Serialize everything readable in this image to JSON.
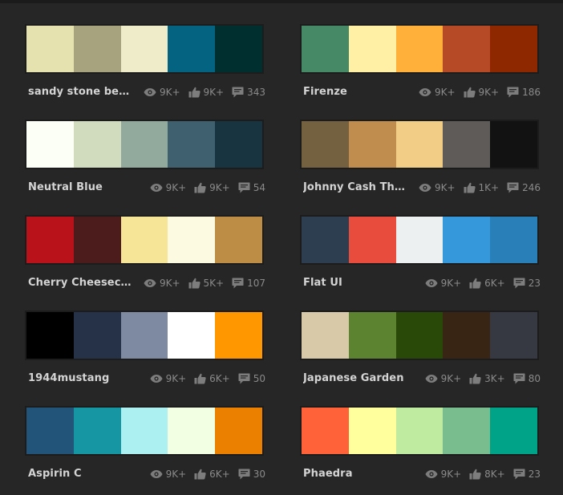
{
  "colors": {
    "background": "#262626",
    "text": "#d4d4d4",
    "muted": "#8a8a8a"
  },
  "icons": {
    "views": "eye-icon",
    "likes": "thumbs-up-icon",
    "comments": "comment-icon"
  },
  "themes": [
    {
      "name": "sandy stone beach ocean diver",
      "views": "9K+",
      "likes": "9K+",
      "comments": "343",
      "swatches": [
        "#E6E2AF",
        "#A7A37E",
        "#EFECCA",
        "#046380",
        "#002F2F"
      ]
    },
    {
      "name": "Firenze",
      "views": "9K+",
      "likes": "9K+",
      "comments": "186",
      "swatches": [
        "#468966",
        "#FFF0A5",
        "#FFB03B",
        "#B64926",
        "#8E2800"
      ]
    },
    {
      "name": "Neutral Blue",
      "views": "9K+",
      "likes": "9K+",
      "comments": "54",
      "swatches": [
        "#FCFFF5",
        "#D1DBBD",
        "#91AA9D",
        "#3E606F",
        "#193441"
      ]
    },
    {
      "name": "Johnny Cash The Man In Black",
      "views": "9K+",
      "likes": "1K+",
      "comments": "246",
      "swatches": [
        "#736140",
        "#C08D4E",
        "#F2CD86",
        "#5F5B59",
        "#121212"
      ]
    },
    {
      "name": "Cherry Cheesecake",
      "views": "9K+",
      "likes": "5K+",
      "comments": "107",
      "swatches": [
        "#B9121B",
        "#4C1B1B",
        "#F6E497",
        "#FCFAE1",
        "#BD8D46"
      ]
    },
    {
      "name": "Flat UI",
      "views": "9K+",
      "likes": "6K+",
      "comments": "23",
      "swatches": [
        "#2C3E50",
        "#E74C3C",
        "#ECF0F1",
        "#3498DB",
        "#2980B9"
      ]
    },
    {
      "name": "1944mustang",
      "views": "9K+",
      "likes": "6K+",
      "comments": "50",
      "swatches": [
        "#000000",
        "#263248",
        "#7E8AA2",
        "#FFFFFF",
        "#FF9800"
      ]
    },
    {
      "name": "Japanese Garden",
      "views": "9K+",
      "likes": "3K+",
      "comments": "80",
      "swatches": [
        "#D8CAA8",
        "#5C832F",
        "#284907",
        "#382513",
        "#363942"
      ]
    },
    {
      "name": "Aspirin C",
      "views": "9K+",
      "likes": "6K+",
      "comments": "30",
      "swatches": [
        "#225378",
        "#1695A3",
        "#ACF0F2",
        "#F3FFE2",
        "#EB7F00"
      ]
    },
    {
      "name": "Phaedra",
      "views": "9K+",
      "likes": "8K+",
      "comments": "23",
      "swatches": [
        "#FF6138",
        "#FFFF9D",
        "#BEEB9F",
        "#79BD8F",
        "#00A388"
      ]
    }
  ]
}
